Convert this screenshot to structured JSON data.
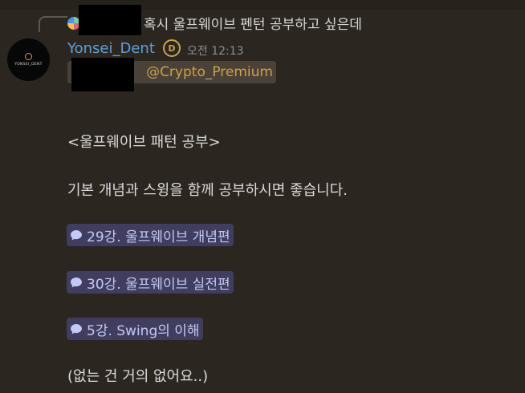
{
  "reply": {
    "text": "혹시 울프웨이브 펜턴 공부하고 싶은데"
  },
  "author": {
    "avatar_text": "YONSEI_DENT",
    "username": "Yonsei_Dent",
    "timestamp": "오전 12:13"
  },
  "message": {
    "mention": "@Crypto_Premium",
    "heading": "<울프웨이브 패턴 공부>",
    "intro": "기본 개념과 스윙을 함께 공부하시면 좋습니다.",
    "channel_links": [
      {
        "label": "29강. 울프웨이브 개념편",
        "icon": "speech-bubble-icon"
      },
      {
        "label": "30강. 울프웨이브 실전편",
        "icon": "speech-bubble-icon"
      },
      {
        "label": "5강. Swing의 이해",
        "icon": "speech-bubble-icon"
      }
    ],
    "outro": "(없는 건 거의 없어요..)"
  },
  "colors": {
    "background": "#2b2620",
    "username": "#5e9fd8",
    "mention_text": "#c9a24f",
    "mention_bg": "#4a4138",
    "link_bg": "#403d5e",
    "link_text": "#c4c9f5",
    "timestamp": "#8e8e8e"
  }
}
